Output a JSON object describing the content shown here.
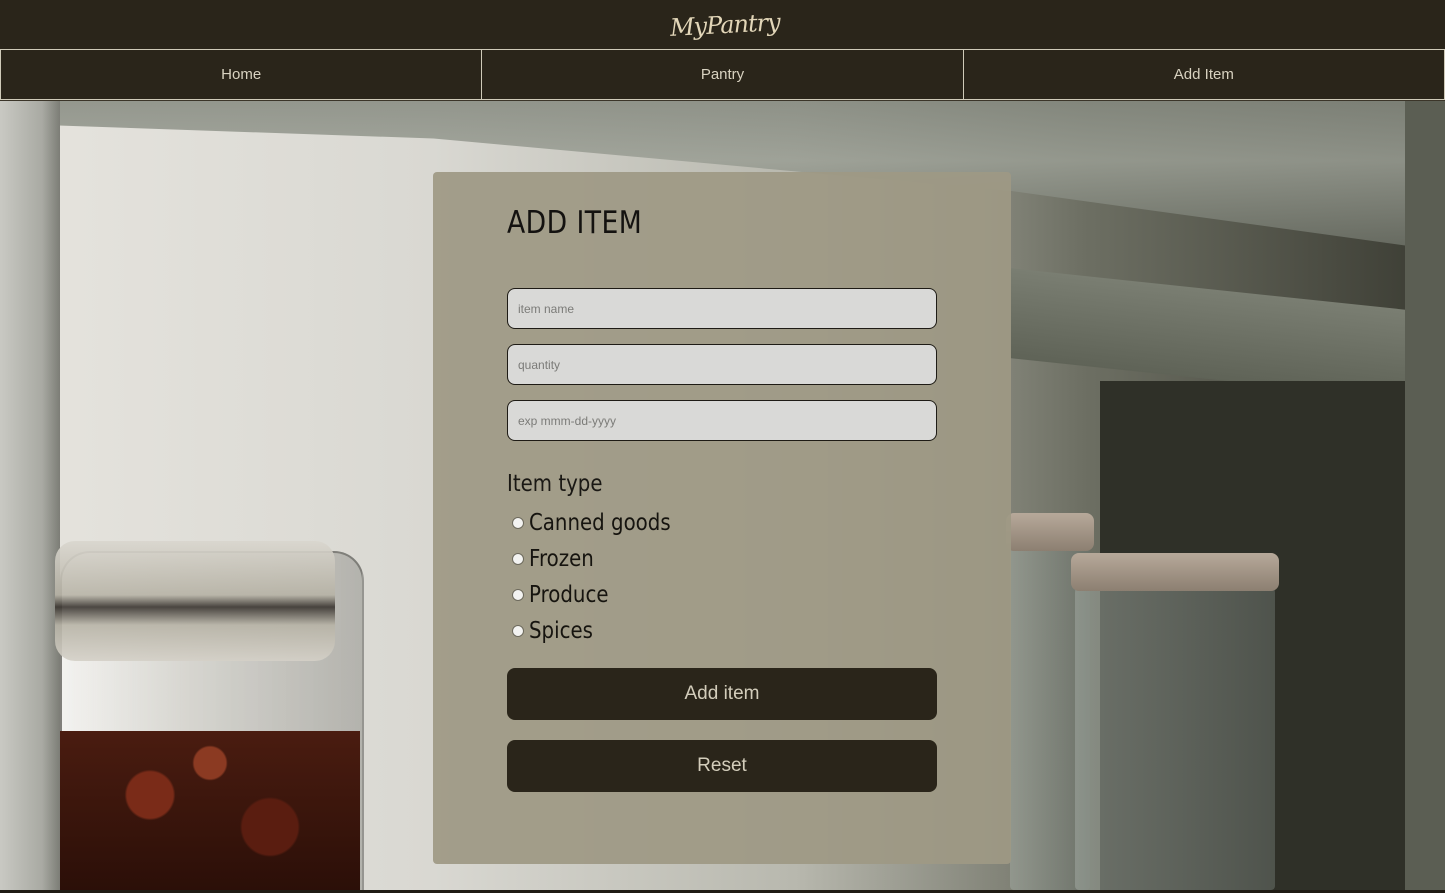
{
  "header": {
    "logo_text": "MyPantry"
  },
  "nav": {
    "items": [
      {
        "label": "Home"
      },
      {
        "label": "Pantry"
      },
      {
        "label": "Add Item"
      }
    ]
  },
  "form": {
    "title": "ADD ITEM",
    "fields": {
      "item_name": {
        "placeholder": "item name",
        "value": ""
      },
      "quantity": {
        "placeholder": "quantity",
        "value": ""
      },
      "expiration": {
        "placeholder": "exp mmm-dd-yyyy",
        "value": ""
      }
    },
    "item_type": {
      "label": "Item type",
      "options": [
        {
          "label": "Canned goods",
          "selected": false
        },
        {
          "label": "Frozen",
          "selected": false
        },
        {
          "label": "Produce",
          "selected": false
        },
        {
          "label": "Spices",
          "selected": false
        }
      ]
    },
    "buttons": {
      "add_label": "Add item",
      "reset_label": "Reset"
    }
  },
  "colors": {
    "header_bg": "#2a251a",
    "card_bg": "#9e9984",
    "button_bg": "#2a251a",
    "button_text": "#d3cdbb",
    "logo_color": "#e2d6b8"
  }
}
